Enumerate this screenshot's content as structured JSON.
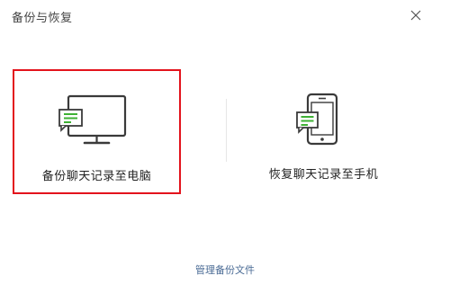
{
  "window": {
    "title": "备份与恢复"
  },
  "options": [
    {
      "label": "备份聊天记录至电脑",
      "icon": "monitor-chat-icon",
      "selected": true
    },
    {
      "label": "恢复聊天记录至手机",
      "icon": "phone-chat-icon",
      "selected": false
    }
  ],
  "footer": {
    "manage_link": "管理备份文件"
  },
  "colors": {
    "accent_green": "#3eb134",
    "selection_border": "#e3131c",
    "link": "#4a6b95",
    "icon_stroke": "#3a3a3a"
  }
}
